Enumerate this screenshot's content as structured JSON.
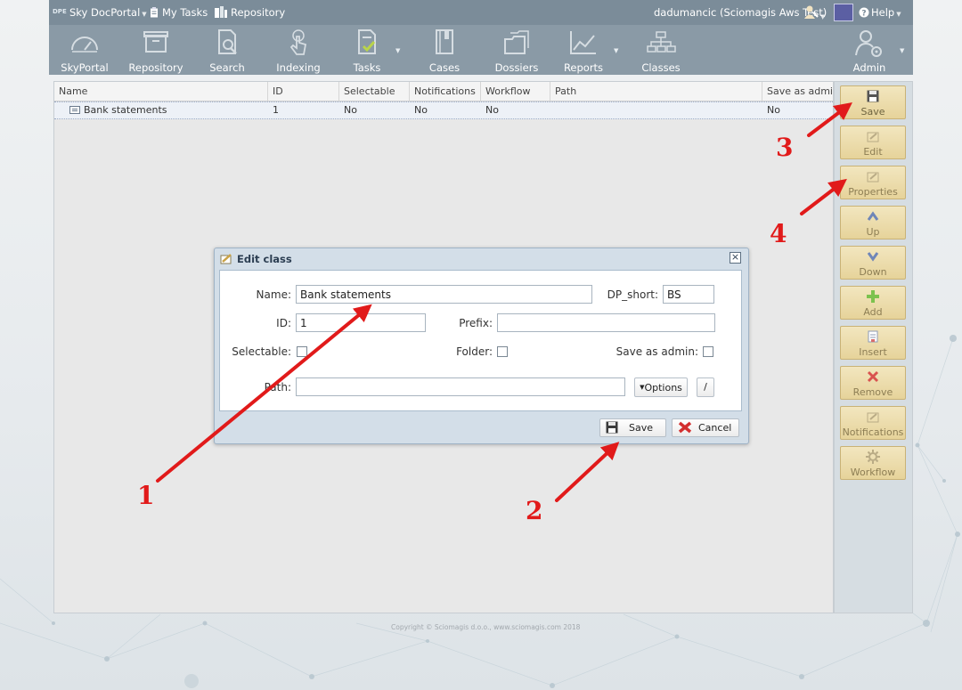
{
  "topbar": {
    "logo_badge": "DPE",
    "app_name": "Sky DocPortal",
    "my_tasks": "My Tasks",
    "repository": "Repository",
    "user": "dadumancic (Sciomagis Aws Test)",
    "help": "Help",
    "swatch_color": "#5b5fa3"
  },
  "nav": {
    "items": [
      {
        "label": "SkyPortal",
        "icon": "gauge-icon"
      },
      {
        "label": "Repository",
        "icon": "archive-box-icon"
      },
      {
        "label": "Search",
        "icon": "document-search-icon"
      },
      {
        "label": "Indexing",
        "icon": "touch-finger-icon"
      },
      {
        "label": "Tasks",
        "icon": "task-check-icon"
      },
      {
        "label": "Cases",
        "icon": "book-icon"
      },
      {
        "label": "Dossiers",
        "icon": "folders-icon"
      },
      {
        "label": "Reports",
        "icon": "line-chart-icon"
      },
      {
        "label": "Classes",
        "icon": "hierarchy-icon"
      },
      {
        "label": "Admin",
        "icon": "admin-user-gear-icon"
      }
    ]
  },
  "table": {
    "columns": [
      "Name",
      "ID",
      "Selectable",
      "Notifications",
      "Workflow",
      "Path",
      "Save as admin."
    ],
    "rows": [
      {
        "name": "Bank statements",
        "id": "1",
        "selectable": "No",
        "notifications": "No",
        "workflow": "No",
        "path": "",
        "save_as_admin": "No"
      }
    ]
  },
  "sidebar": {
    "buttons": [
      "Save",
      "Edit",
      "Properties",
      "Up",
      "Down",
      "Add",
      "Insert",
      "Remove",
      "Notifications",
      "Workflow"
    ]
  },
  "dialog": {
    "title": "Edit class",
    "name_label": "Name:",
    "name_value": "Bank statements",
    "dp_short_label": "DP_short:",
    "dp_short_value": "BS",
    "id_label": "ID:",
    "id_value": "1",
    "prefix_label": "Prefix:",
    "prefix_value": "",
    "selectable_label": "Selectable:",
    "folder_label": "Folder:",
    "save_as_admin_label": "Save as admin:",
    "path_label": "Path:",
    "path_value": "",
    "options_label": "Options",
    "slash_label": "/",
    "save_label": "Save",
    "cancel_label": "Cancel"
  },
  "annotations": [
    "1",
    "2",
    "3",
    "4"
  ],
  "footer": {
    "copyright": "Copyright © Sciomagis d.o.o., www.sciomagis.com 2018"
  },
  "colors": {
    "topbar": "#7b8c99",
    "navbar": "#8a9aa6",
    "sidebar_button": "#e6d39a",
    "annotation": "#e11a1a"
  }
}
